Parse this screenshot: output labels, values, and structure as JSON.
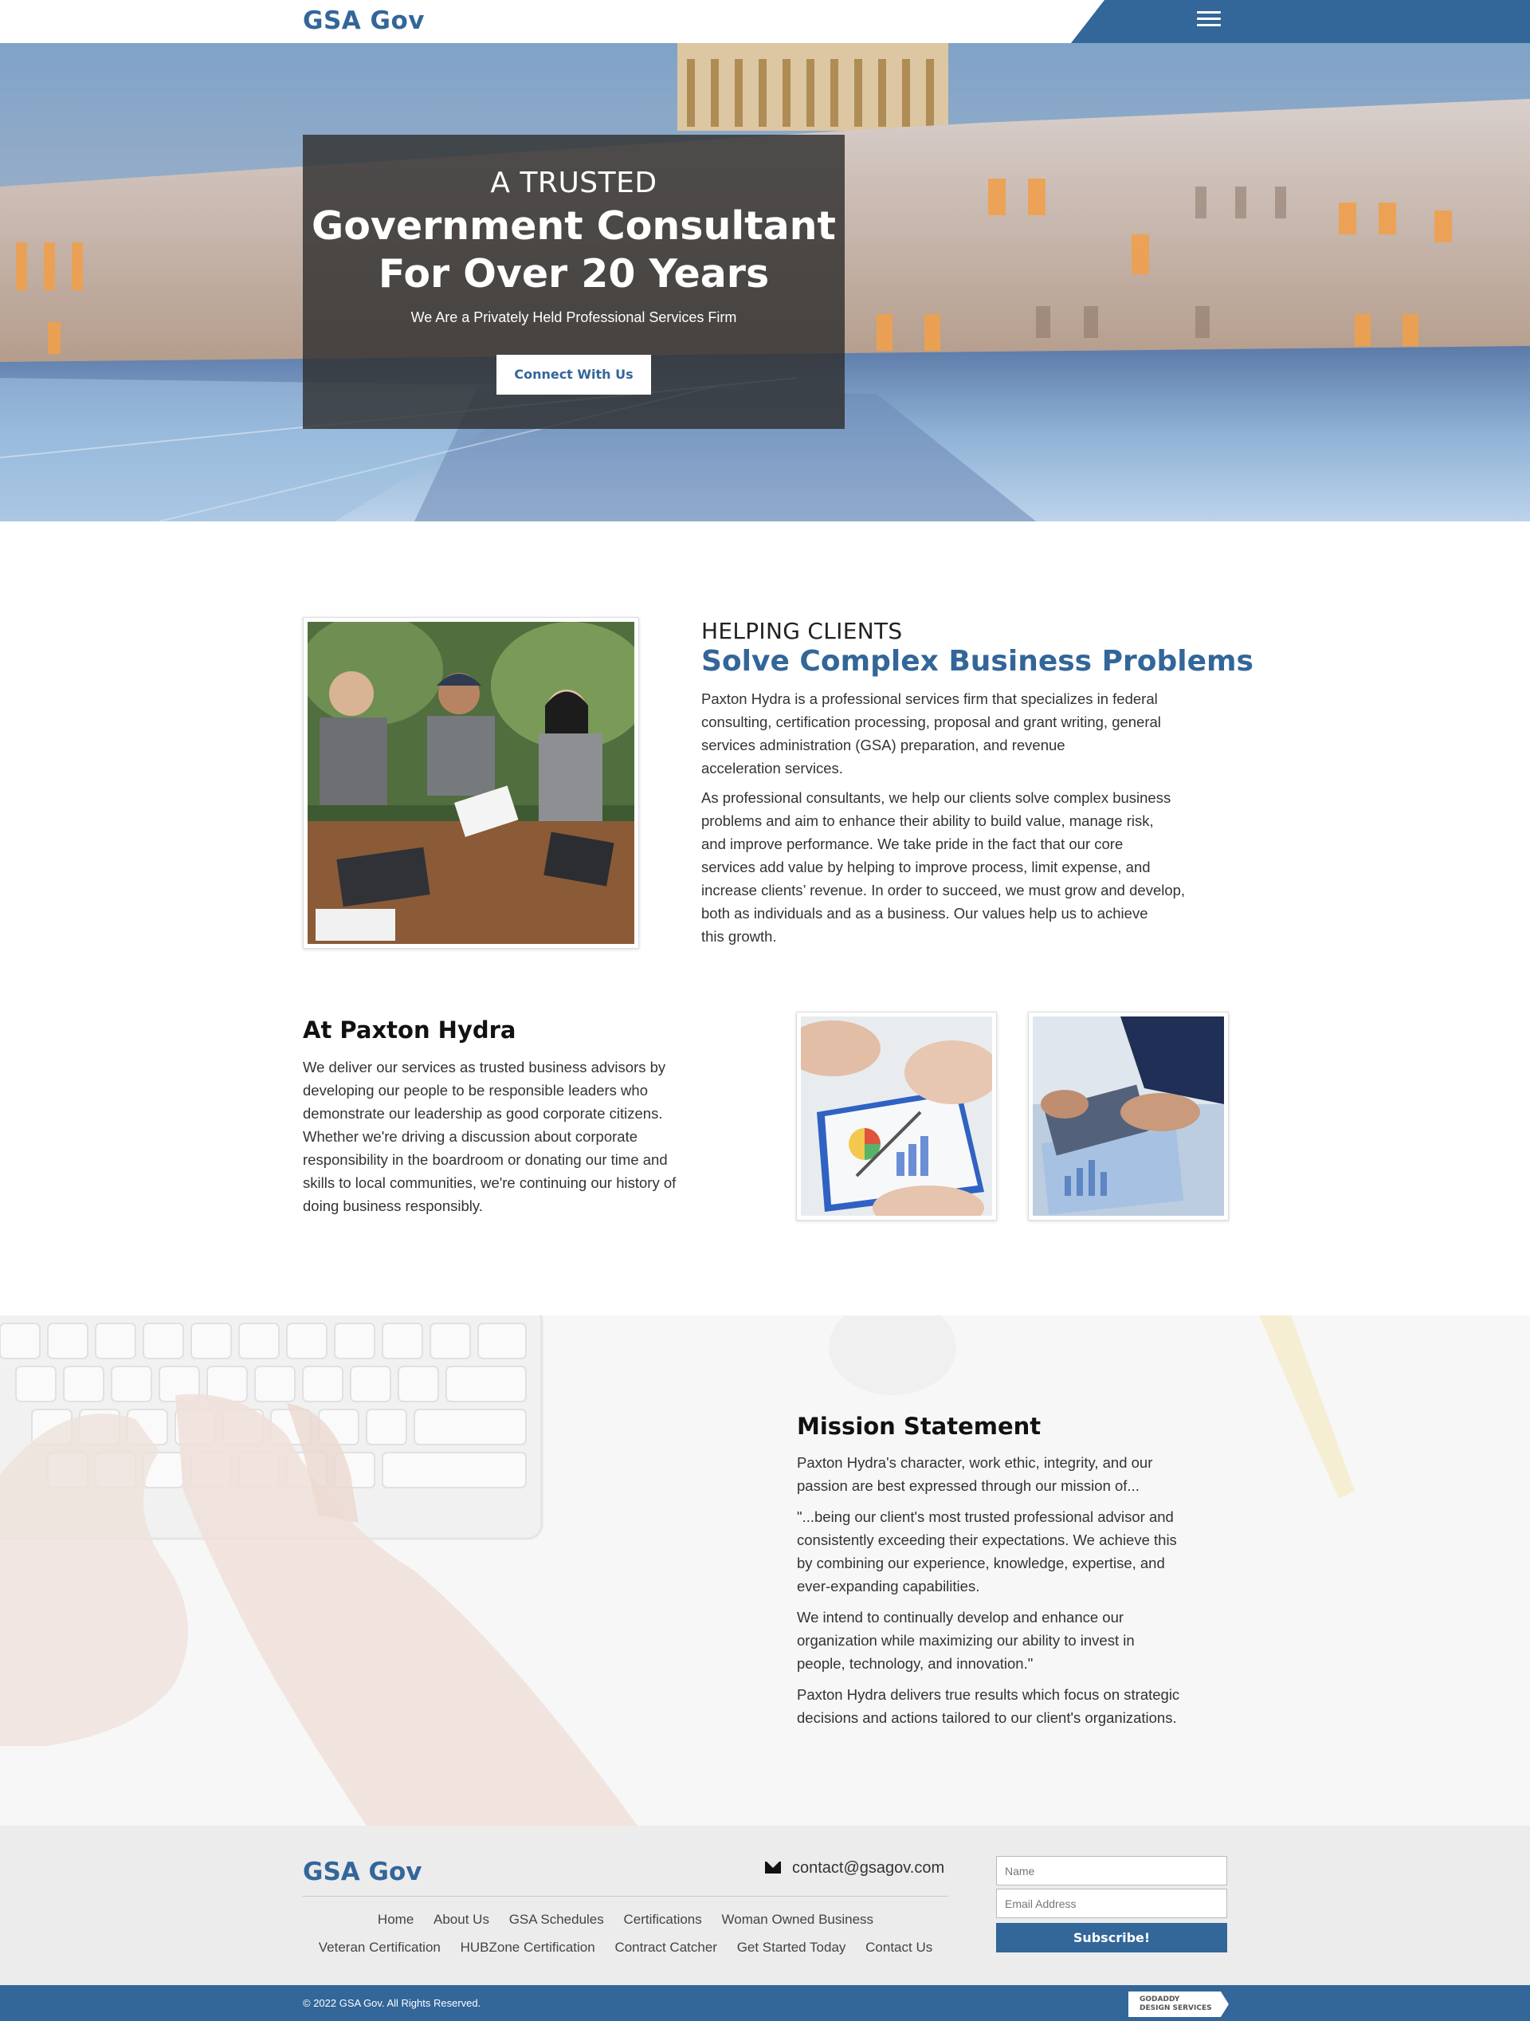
{
  "header": {
    "logo": "GSA Gov",
    "menu_icon": "hamburger-menu-icon"
  },
  "hero": {
    "kicker": "A TRUSTED",
    "title_line1": "Government Consultant",
    "title_line2": "For Over 20 Years",
    "subtitle": "We Are a Privately Held Professional Services Firm",
    "cta_label": "Connect With Us"
  },
  "about": {
    "kicker": "HELPING CLIENTS",
    "headline": "Solve Complex Business Problems",
    "para1": [
      "Paxton Hydra is a professional services firm that specializes in federal",
      "consulting, certification processing, proposal and grant writing, general",
      "services administration (GSA) preparation, and revenue",
      "acceleration services."
    ],
    "para2": [
      "As professional consultants, we help our clients solve complex business",
      "problems and aim to enhance their ability to build value, manage risk,",
      "and improve performance. We take pride in the fact that our core",
      "services add value by helping to improve process, limit expense, and",
      "increase clients’ revenue. In order to succeed, we must grow and develop,",
      "both as individuals and as a business. Our values help us to achieve",
      "this growth."
    ]
  },
  "paxton": {
    "heading": "At Paxton Hydra",
    "para": [
      "We deliver our services as trusted business advisors by",
      "developing our people to be responsible leaders who",
      "demonstrate our leadership as good corporate citizens.",
      "Whether we're driving a discussion about corporate",
      "responsibility in the boardroom or donating our time and",
      "skills to local communities, we're continuing our history of",
      "doing business responsibly."
    ]
  },
  "mission": {
    "heading": "Mission Statement",
    "p1": [
      "Paxton Hydra's character, work ethic, integrity, and our",
      "passion are best expressed through our mission of..."
    ],
    "p2": [
      "\"...being our client's most trusted professional advisor and",
      "consistently exceeding their expectations. We achieve this",
      "by combining our experience, knowledge, expertise, and",
      "ever-expanding capabilities."
    ],
    "p3": [
      "We intend to continually develop and enhance our",
      "organization while maximizing our ability to invest in",
      "people, technology, and innovation.\""
    ],
    "p4": [
      "Paxton Hydra delivers true results which focus on strategic",
      "decisions and actions tailored to our client's organizations."
    ]
  },
  "footer": {
    "logo": "GSA Gov",
    "email": "contact@gsagov.com",
    "links_row1": [
      "Home",
      "About Us",
      "GSA Schedules",
      "Certifications",
      "Woman Owned Business"
    ],
    "links_row2": [
      "Veteran Certification",
      "HUBZone Certification",
      "Contract Catcher",
      "Get Started Today",
      "Contact Us"
    ],
    "name_placeholder": "Name",
    "email_placeholder": "Email Address",
    "subscribe_label": "Subscribe!",
    "copyright": "© 2022 GSA Gov. All Rights Reserved.",
    "badge_line1": "GODADDY",
    "badge_line2": "DESIGN SERVICES"
  },
  "colors": {
    "brand": "#336699",
    "footer_bg": "#ececec"
  }
}
